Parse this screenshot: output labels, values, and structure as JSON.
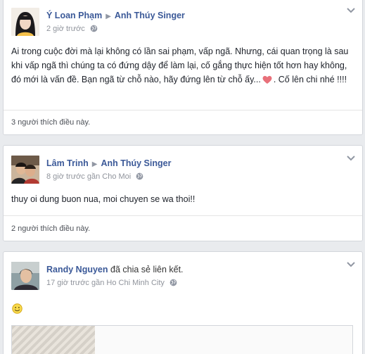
{
  "posts": [
    {
      "author": "Ý Loan Phạm",
      "target": "Anh Thúy Singer",
      "time": "2 giờ trước",
      "text_before_heart": "Ai trong cuộc đời mà lại không có lần sai phạm, vấp ngã. Nhưng, cái quan trọng là sau khi vấp ngã thì chúng ta có đứng dậy để làm lại, cố gắng thực hiện tốt hơn hay không, đó mới là vấn đề. Bạn ngã từ chỗ nào, hãy đứng lên từ chỗ ấy...",
      "text_after_heart": ". Cố lên chi nhé !!!!",
      "likes": "3 người thích điều này."
    },
    {
      "author": "Lâm Trinh",
      "target": "Anh Thúy Singer",
      "time": "8 giờ trước gần Cho Moi",
      "text": "thuy oi dung buon nua, moi chuyen se wa thoi!!",
      "likes": "2 người thích điều này."
    },
    {
      "author": "Randy Nguyen",
      "action": "đã chia sẻ liên kết.",
      "time": "17 giờ trước gần Ho Chi Minh City"
    }
  ],
  "colors": {
    "link": "#3b5998",
    "meta": "#90949c",
    "heart": "#e8707a"
  }
}
